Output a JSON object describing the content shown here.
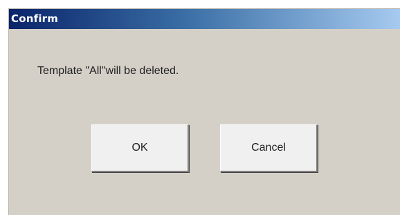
{
  "dialog": {
    "title": "Confirm",
    "message": "Template \"All\"will be deleted.",
    "buttons": {
      "ok_label": "OK",
      "cancel_label": "Cancel"
    }
  },
  "colors": {
    "titlebar_start": "#0a246a",
    "titlebar_end": "#a6caf0",
    "dialog_background": "#d4d0c8"
  }
}
